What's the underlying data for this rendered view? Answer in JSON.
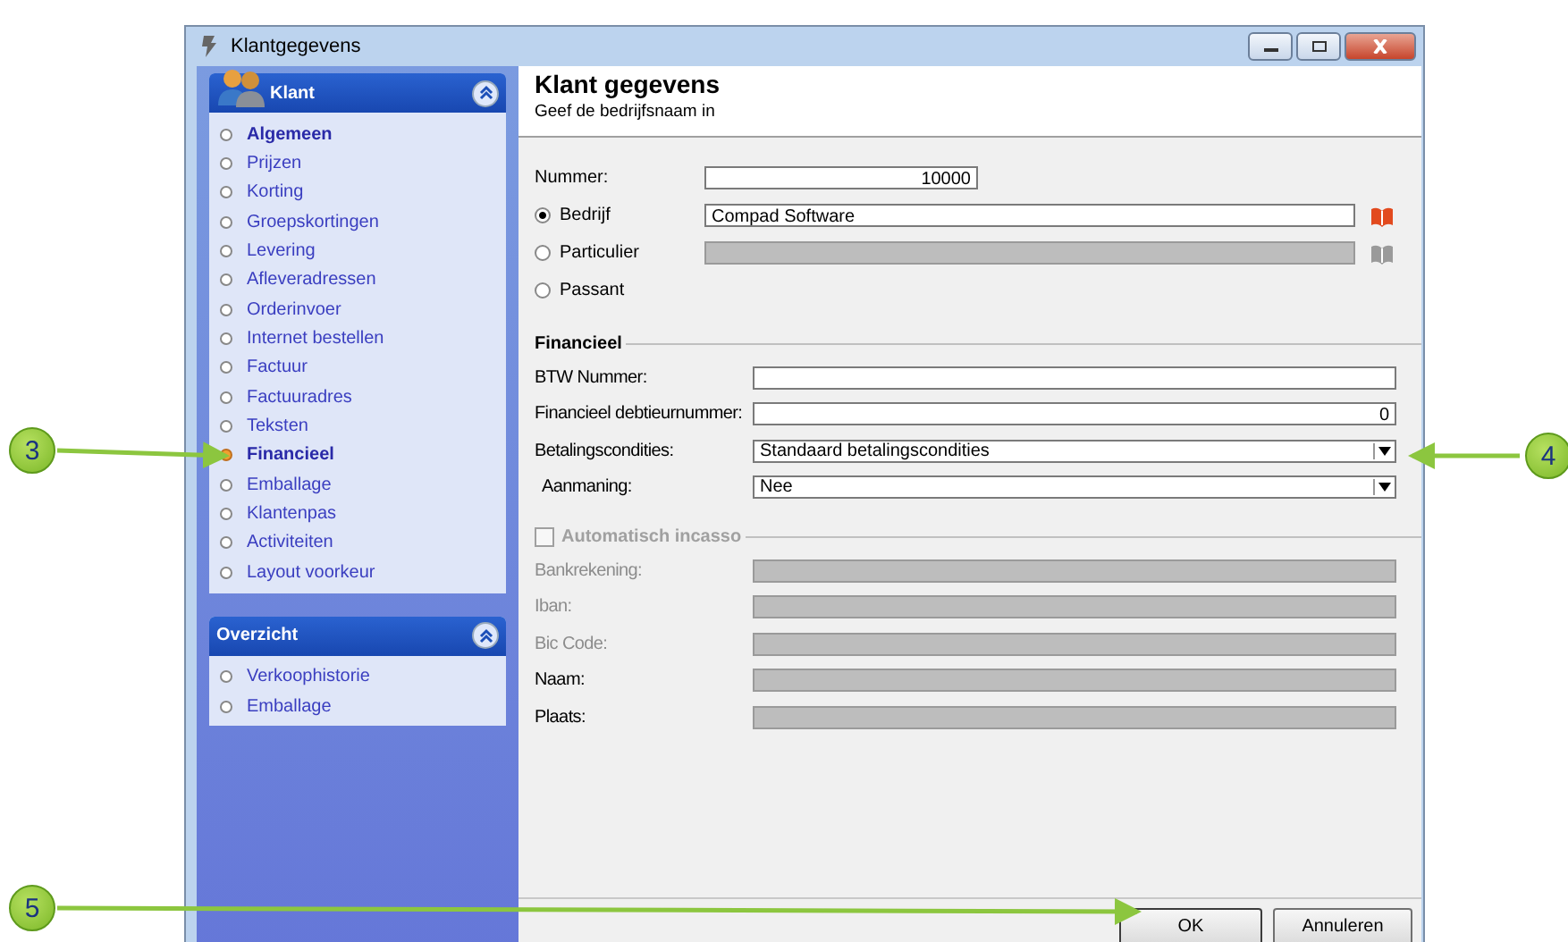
{
  "window": {
    "title": "Klantgegevens"
  },
  "sidebar": {
    "panels": [
      {
        "title": "Klant",
        "icon": true,
        "items": [
          {
            "label": "Algemeen",
            "bold": true,
            "selected": false
          },
          {
            "label": "Prijzen",
            "bold": false,
            "selected": false
          },
          {
            "label": "Korting",
            "bold": false,
            "selected": false
          },
          {
            "label": "Groepskortingen",
            "bold": false,
            "selected": false
          },
          {
            "label": "Levering",
            "bold": false,
            "selected": false
          },
          {
            "label": "Afleveradressen",
            "bold": false,
            "selected": false
          },
          {
            "label": "Orderinvoer",
            "bold": false,
            "selected": false
          },
          {
            "label": "Internet bestellen",
            "bold": false,
            "selected": false
          },
          {
            "label": "Factuur",
            "bold": false,
            "selected": false
          },
          {
            "label": "Factuuradres",
            "bold": false,
            "selected": false
          },
          {
            "label": "Teksten",
            "bold": false,
            "selected": false
          },
          {
            "label": "Financieel",
            "bold": true,
            "selected": true
          },
          {
            "label": "Emballage",
            "bold": false,
            "selected": false
          },
          {
            "label": "Klantenpas",
            "bold": false,
            "selected": false
          },
          {
            "label": "Activiteiten",
            "bold": false,
            "selected": false
          },
          {
            "label": "Layout voorkeur",
            "bold": false,
            "selected": false
          }
        ]
      },
      {
        "title": "Overzicht",
        "icon": false,
        "items": [
          {
            "label": "Verkoophistorie",
            "bold": false,
            "selected": false
          },
          {
            "label": "Emballage",
            "bold": false,
            "selected": false
          }
        ]
      }
    ]
  },
  "header": {
    "title": "Klant gegevens",
    "subtitle": "Geef de bedrijfsnaam in"
  },
  "top_fields": [
    {
      "kind": "number",
      "label": "Nummer:",
      "value": "10000",
      "disabled": false
    },
    {
      "kind": "radio",
      "label": "Bedrijf",
      "selected": true,
      "value": "Compad Software",
      "disabled": false
    },
    {
      "kind": "radio",
      "label": "Particulier",
      "selected": false,
      "disabled": true
    },
    {
      "kind": "radio",
      "label": "Passant",
      "selected": false
    }
  ],
  "financieel": {
    "legend": "Financieel",
    "fields": [
      {
        "kind": "text",
        "label": "BTW Nummer:",
        "disabled": false
      },
      {
        "kind": "number",
        "label": "Financieel debtieurnummer:",
        "value": "0",
        "disabled": false
      },
      {
        "kind": "dropdown",
        "label": "Betalingscondities:",
        "value": "Standaard betalingscondities",
        "disabled": false
      },
      {
        "kind": "dropdown",
        "label": "Aanmaning:",
        "value": "Nee",
        "disabled": false
      }
    ]
  },
  "incasso": {
    "legend": "Automatisch incasso",
    "checked": false,
    "disabled": true,
    "fields": [
      {
        "kind": "text",
        "label": "Bankrekening:",
        "disabled": true,
        "label_disabled": true
      },
      {
        "kind": "text",
        "label": "Iban:",
        "disabled": true,
        "label_disabled": true
      },
      {
        "kind": "text",
        "label": "Bic Code:",
        "disabled": true,
        "label_disabled": true
      },
      {
        "kind": "text",
        "label": "Naam:",
        "disabled": true,
        "label_disabled": false
      },
      {
        "kind": "text",
        "label": "Plaats:",
        "disabled": true,
        "label_disabled": false
      }
    ]
  },
  "buttons": [
    "OK",
    "Annuleren"
  ],
  "callouts": [
    "3",
    "4",
    "5"
  ]
}
